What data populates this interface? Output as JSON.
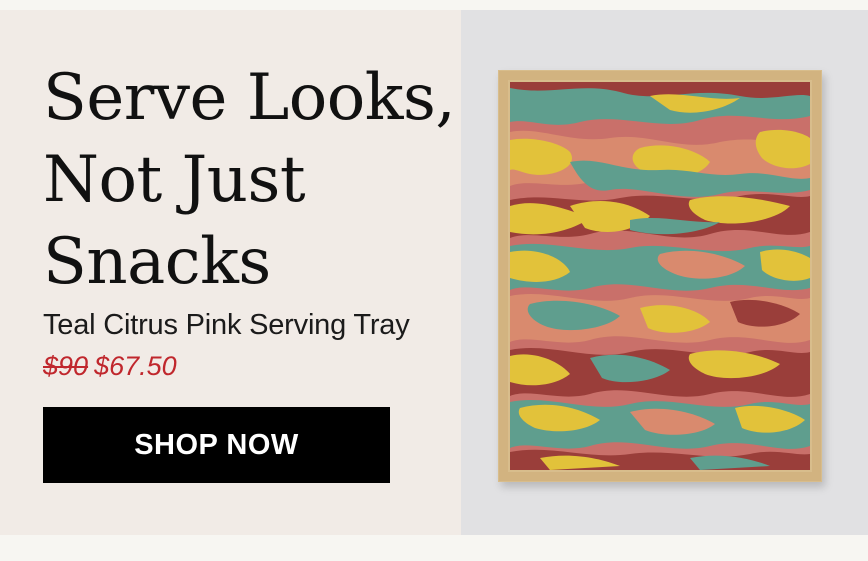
{
  "promo": {
    "headline_lines": [
      "Serve Looks,",
      "Not Just",
      "Snacks"
    ],
    "product_name": "Teal Citrus Pink Serving Tray",
    "price_original": "$90",
    "price_sale": "$67.50",
    "cta_label": "SHOP NOW"
  },
  "colors": {
    "left_panel": "#f1ebe6",
    "right_panel": "#e1e1e3",
    "sale_price": "#c0272d",
    "cta_background": "#000000",
    "cta_text": "#ffffff",
    "tray_frame": "#d8bd8c",
    "marble": [
      "#5f9e8e",
      "#e2c23a",
      "#d98a6e",
      "#9a3e3a"
    ]
  }
}
